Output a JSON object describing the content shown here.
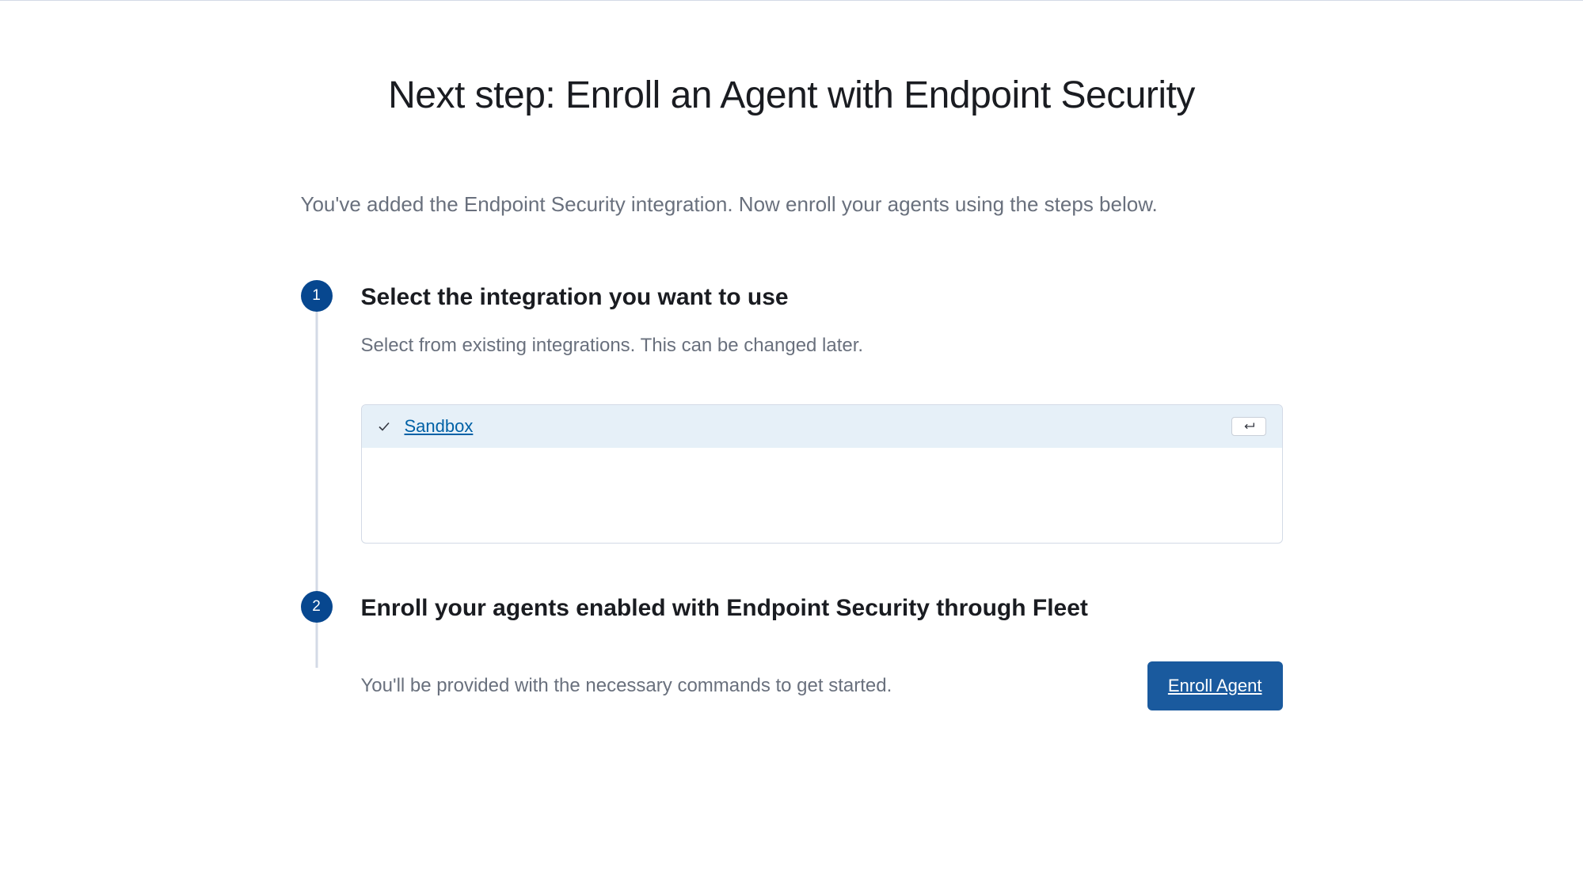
{
  "page": {
    "title": "Next step: Enroll an Agent with Endpoint Security",
    "subtitle": "You've added the Endpoint Security integration. Now enroll your agents using the steps below."
  },
  "steps": {
    "step1": {
      "number": "1",
      "title": "Select the integration you want to use",
      "description": "Select from existing integrations. This can be changed later.",
      "selected_option": "Sandbox"
    },
    "step2": {
      "number": "2",
      "title": "Enroll your agents enabled with Endpoint Security through Fleet",
      "description": "You'll be provided with the necessary commands to get started.",
      "button_label": "Enroll Agent"
    }
  }
}
